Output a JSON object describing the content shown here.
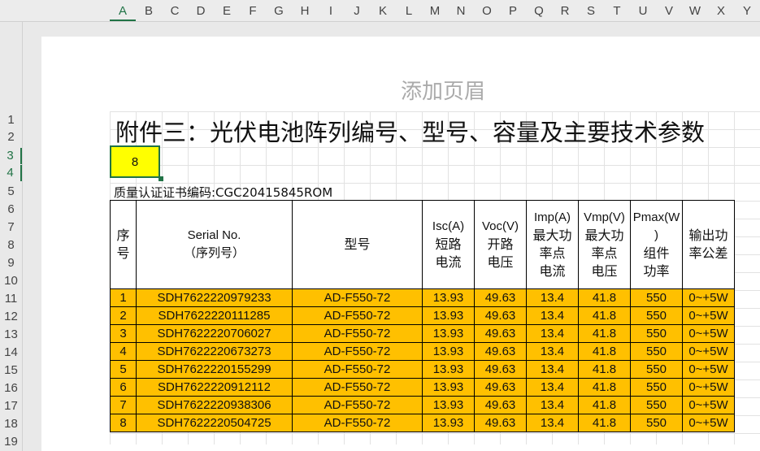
{
  "columns": [
    "A",
    "B",
    "C",
    "D",
    "E",
    "F",
    "G",
    "H",
    "I",
    "J",
    "K",
    "L",
    "M",
    "N",
    "O",
    "P",
    "Q",
    "R",
    "S",
    "T",
    "U",
    "V",
    "W",
    "X",
    "Y"
  ],
  "rows": [
    "1",
    "2",
    "3",
    "4",
    "5",
    "6",
    "7",
    "8",
    "9",
    "10",
    "11",
    "12",
    "13",
    "14",
    "15",
    "16",
    "17",
    "18",
    "19"
  ],
  "header_placeholder": "添加页眉",
  "title": "附件三：光伏电池阵列编号、型号、容量及主要技术参数",
  "active_cell_value": "8",
  "cert_line": "质量认证证书编码:CGC20415845ROM",
  "table_headers": [
    {
      "lines": [
        "序",
        "号"
      ]
    },
    {
      "lines": [
        "Serial No.",
        "（序列号）"
      ]
    },
    {
      "lines": [
        "型号"
      ]
    },
    {
      "lines": [
        "Isc(A)",
        "短路",
        "电流"
      ]
    },
    {
      "lines": [
        "Voc(V)",
        "开路",
        "电压"
      ]
    },
    {
      "lines": [
        "Imp(A)",
        "最大功",
        "率点",
        "电流"
      ]
    },
    {
      "lines": [
        "Vmp(V)",
        "最大功",
        "率点",
        "电压"
      ]
    },
    {
      "lines": [
        "Pmax(W",
        ")",
        "组件",
        "功率"
      ]
    },
    {
      "lines": [
        "输出功",
        "率公差"
      ]
    }
  ],
  "table_rows": [
    [
      "1",
      "SDH7622220979233",
      "AD-F550-72",
      "13.93",
      "49.63",
      "13.4",
      "41.8",
      "550",
      "0~+5W"
    ],
    [
      "2",
      "SDH7622220111285",
      "AD-F550-72",
      "13.93",
      "49.63",
      "13.4",
      "41.8",
      "550",
      "0~+5W"
    ],
    [
      "3",
      "SDH7622220706027",
      "AD-F550-72",
      "13.93",
      "49.63",
      "13.4",
      "41.8",
      "550",
      "0~+5W"
    ],
    [
      "4",
      "SDH7622220673273",
      "AD-F550-72",
      "13.93",
      "49.63",
      "13.4",
      "41.8",
      "550",
      "0~+5W"
    ],
    [
      "5",
      "SDH7622220155299",
      "AD-F550-72",
      "13.93",
      "49.63",
      "13.4",
      "41.8",
      "550",
      "0~+5W"
    ],
    [
      "6",
      "SDH7622220912112",
      "AD-F550-72",
      "13.93",
      "49.63",
      "13.4",
      "41.8",
      "550",
      "0~+5W"
    ],
    [
      "7",
      "SDH7622220938306",
      "AD-F550-72",
      "13.93",
      "49.63",
      "13.4",
      "41.8",
      "550",
      "0~+5W"
    ],
    [
      "8",
      "SDH7622220504725",
      "AD-F550-72",
      "13.93",
      "49.63",
      "13.4",
      "41.8",
      "550",
      "0~+5W"
    ]
  ],
  "colors": {
    "row_fill": "#ffc000",
    "active_cell_fill": "#ffff00",
    "selection": "#217346"
  }
}
